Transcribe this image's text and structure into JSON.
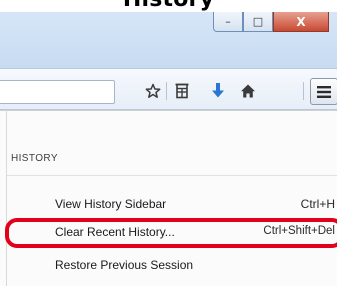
{
  "page": {
    "heading_fragment": "History"
  },
  "window": {
    "minimize_glyph": "–",
    "maximize_glyph": "□",
    "close_glyph": "X"
  },
  "toolbar": {
    "icons": [
      "star-icon",
      "reading-list-icon",
      "download-arrow-icon",
      "home-icon",
      "hamburger-menu-icon"
    ],
    "download_color": "#2b76d2"
  },
  "history_panel": {
    "header": "HISTORY",
    "items": [
      {
        "label": "View History Sidebar",
        "shortcut": "Ctrl+H"
      },
      {
        "label": "Clear Recent History...",
        "shortcut": "Ctrl+Shift+Del",
        "highlighted": true
      },
      {
        "label": "Restore Previous Session",
        "shortcut": ""
      }
    ],
    "highlight_color": "#e2001a"
  }
}
